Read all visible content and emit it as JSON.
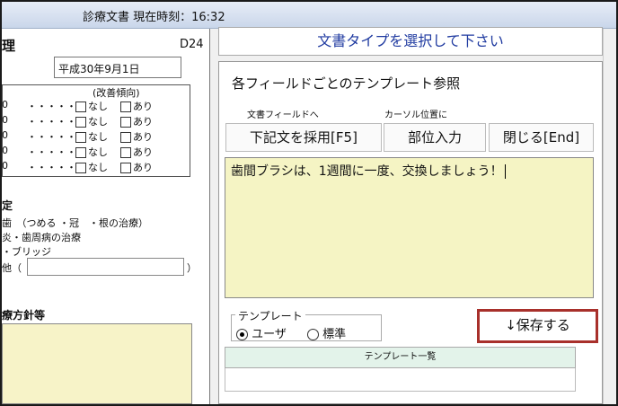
{
  "window": {
    "title": "診療文書 現在時刻：16:32"
  },
  "left": {
    "heading_fragment": "理",
    "code": "D24",
    "date_value": "平成30年9月1日",
    "group_header": "(改善傾向)",
    "rows": [
      {
        "lead": "0",
        "dots": "・・・・・・",
        "none": "なし",
        "yes": "あり"
      },
      {
        "lead": "0",
        "dots": "・・・・・・",
        "none": "なし",
        "yes": "あり"
      },
      {
        "lead": "0",
        "dots": "・・・・・・",
        "none": "なし",
        "yes": "あり"
      },
      {
        "lead": "0",
        "dots": "・・・・・・",
        "none": "なし",
        "yes": "あり"
      },
      {
        "lead": "0",
        "dots": "・・・・・・",
        "none": "なし",
        "yes": "あり"
      }
    ],
    "plan_heading": "定",
    "plan_line1": "歯　（つめる ・冠　・根の治療）",
    "plan_line2": "炎・歯周病の治療",
    "plan_line3": "・ブリッジ",
    "plan_line4": "他（",
    "plan_line4_close": "）",
    "policy_heading": "療方針等"
  },
  "right": {
    "header": "文書タイプを選択して下さい",
    "section_title": "各フィールドごとのテンプレート参照",
    "small_label_1": "文書フィールドへ",
    "small_label_2": "カーソル位置に",
    "btn_adopt": "下記文を採用[F5]",
    "btn_site": "部位入力",
    "btn_close": "閉じる[End]",
    "text_content": "歯間ブラシは、1週間に一度、交換しましょう！",
    "template_legend": "テンプレート",
    "radio_user": "ユーザ",
    "radio_standard": "標準",
    "save_button": "↓保存する",
    "list_header": "テンプレート一覧"
  },
  "colors": {
    "save_border": "#a8302b",
    "header_text": "#1f3aa0",
    "textarea_bg": "#f5f4c4"
  }
}
